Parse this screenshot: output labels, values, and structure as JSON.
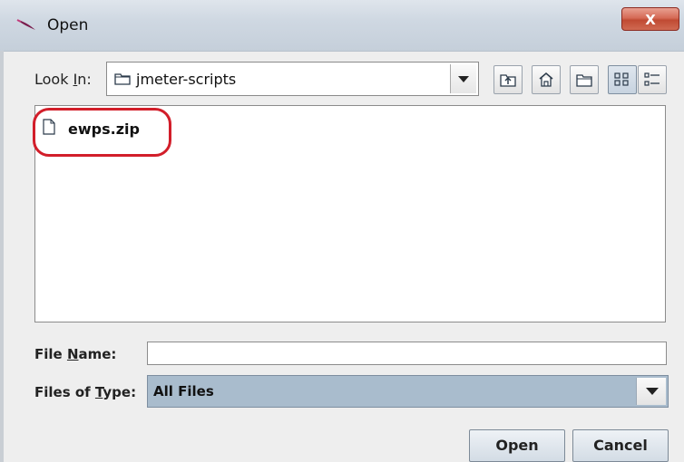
{
  "window": {
    "title": "Open",
    "close_label": "X"
  },
  "lookin": {
    "label_prefix": "Look ",
    "label_underlined": "I",
    "label_suffix": "n:",
    "current_folder": "jmeter-scripts"
  },
  "toolbar": {
    "buttons": [
      "up-one-level-icon",
      "home-icon",
      "new-folder-icon",
      "list-view-icon",
      "details-view-icon"
    ],
    "active": "list-view-icon"
  },
  "files": [
    {
      "name": "ewps.zip",
      "icon": "file-icon",
      "highlighted": true
    }
  ],
  "filename": {
    "label_prefix": "File ",
    "label_underlined": "N",
    "label_suffix": "ame:",
    "value": ""
  },
  "filetype": {
    "label_prefix": "Files of ",
    "label_underlined": "T",
    "label_suffix": "ype:",
    "value": "All Files"
  },
  "buttons": {
    "open": "Open",
    "cancel": "Cancel"
  },
  "colors": {
    "highlight_ring": "#d21e2a",
    "selected_combo": "#a9bccd"
  }
}
